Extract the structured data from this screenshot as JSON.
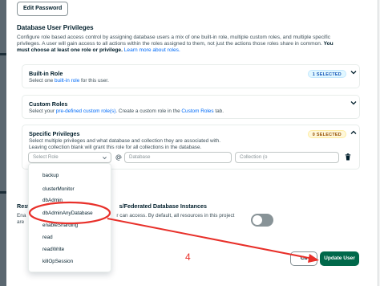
{
  "edit_password_label": "Edit Password",
  "section": {
    "title": "Database User Privileges",
    "desc_line1": "Configure role based access control by assigning database users a mix of one built-in role, multiple custom roles, and multiple specific",
    "desc_line2": "privileges. A user will gain access to all actions within the roles assigned to them, not just the actions those roles share in common.",
    "desc_bold": "You",
    "desc_line3_bold": "must choose at least one role or privilege.",
    "desc_link": "Learn more about roles."
  },
  "builtin_role": {
    "title": "Built-in Role",
    "sub_prefix": "Select one",
    "sub_link": "built-in role",
    "sub_suffix": "for this user.",
    "badge": "1 SELECTED"
  },
  "custom_roles": {
    "title": "Custom Roles",
    "sub_prefix": "Select your",
    "sub_link": "pre-defined custom role(s)",
    "sub_middle": ". Create a custom role in the",
    "sub_link2": "Custom Roles",
    "sub_suffix": "tab."
  },
  "specific_privileges": {
    "title": "Specific Privileges",
    "sub_line1": "Select multiple privileges and what database and collection they are associated with.",
    "sub_line2": "Leaving collection blank will grant this role for all collections in the database.",
    "badge": "0 SELECTED",
    "select_role_placeholder": "Select Role",
    "database_placeholder": "Database",
    "collection_placeholder": "Collection (o"
  },
  "dropdown_items": [
    "backup",
    "clusterMonitor",
    "dbAdmin",
    "dbAdminAnyDatabase",
    "enableSharding",
    "read",
    "readWrite",
    "killOpSession"
  ],
  "access": {
    "title_visible_prefix": "Rest",
    "title_visible_suffix": "s/Federated Database Instances",
    "desc_prefix": "Ena",
    "desc_suffix": "r can access. By default, all resources in this project",
    "desc_line2": "are"
  },
  "cancel_label": "Ca",
  "update_label": "Update User",
  "annotation_step": "4",
  "colors": {
    "annotation": "#e8302a",
    "primary": "#00684a",
    "link": "#016bf8"
  }
}
